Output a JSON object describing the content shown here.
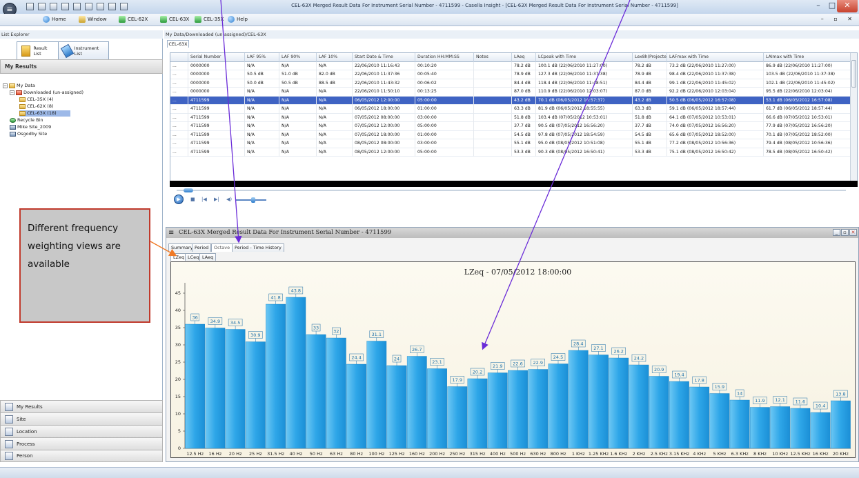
{
  "app": {
    "title": "CEL-63X Merged Result Data For Instrument Serial Number - 4711599 - Casella Insight - [CEL-63X Merged Result Data For Instrument Serial Number - 4711599]",
    "orb_icon": "menu-orb-icon"
  },
  "menu": {
    "items": [
      {
        "label": "Home",
        "icon": "home-icon"
      },
      {
        "label": "Window",
        "icon": "window-icon"
      },
      {
        "label": "CEL-62X",
        "icon": "instrument-icon"
      },
      {
        "label": "CEL-63X",
        "icon": "instrument-icon"
      },
      {
        "label": "CEL-35X",
        "icon": "instrument-icon"
      },
      {
        "label": "Help",
        "icon": "help-icon"
      }
    ]
  },
  "left": {
    "explorer_title": "List Explorer",
    "tabs": [
      {
        "label": "Result List"
      },
      {
        "label": "Instrument List"
      }
    ],
    "section_title": "My Results",
    "tree": {
      "root": "My Data",
      "downloaded": "Downloaded (un-assigned)",
      "cel35": "CEL-35X (4)",
      "cel62": "CEL-62X (8)",
      "cel63": "CEL-63X (18)",
      "recycle": "Recycle Bin",
      "site1": "Mike Site_2009",
      "site2": "Osgodby Site"
    },
    "annotation": "Different frequency weighting views are available",
    "nav": [
      "My Results",
      "Site",
      "Location",
      "Process",
      "Person"
    ]
  },
  "right": {
    "path": "My Data/Downloaded (un-assigned)/CEL-63X",
    "doc_tab": "CEL-63X"
  },
  "grid": {
    "columns": [
      "",
      "Serial Number",
      "LAF 95%",
      "LAF 90%",
      "LAF 10%",
      "Start Date & Time",
      "Duration HH:MM:SS",
      "Notes",
      "LAeq",
      "LCpeak with Time",
      "Lex8h(Projected)",
      "LAFmax with Time",
      "LAImax with Time"
    ],
    "rows": [
      [
        "...",
        "0000000",
        "N/A",
        "N/A",
        "N/A",
        "22/06/2010 11:16:43",
        "00:10:20",
        "",
        "78.2 dB",
        "100.1 dB (22/06/2010 11:27:00)",
        "78.2 dB",
        "73.2 dB (22/06/2010 11:27:00)",
        "86.9 dB (22/06/2010 11:27:00)"
      ],
      [
        "...",
        "0000000",
        "50.5 dB",
        "51.0 dB",
        "82.0 dB",
        "22/06/2010 11:37:36",
        "00:05:40",
        "",
        "78.9 dB",
        "127.3 dB (22/06/2010 11:37:38)",
        "78.9 dB",
        "98.4 dB (22/06/2010 11:37:38)",
        "103.5 dB (22/06/2010 11:37:38)"
      ],
      [
        "...",
        "0000000",
        "50.0 dB",
        "50.5 dB",
        "88.5 dB",
        "22/06/2010 11:43:32",
        "00:06:02",
        "",
        "84.4 dB",
        "118.4 dB (22/06/2010 11:48:51)",
        "84.4 dB",
        "99.1 dB (22/06/2010 11:45:02)",
        "102.1 dB (22/06/2010 11:45:02)"
      ],
      [
        "...",
        "0000000",
        "N/A",
        "N/A",
        "N/A",
        "22/06/2010 11:50:10",
        "00:13:25",
        "",
        "87.0 dB",
        "110.9 dB (22/06/2010 12:03:07)",
        "87.0 dB",
        "92.2 dB (22/06/2010 12:03:04)",
        "95.5 dB (22/06/2010 12:03:04)"
      ],
      [
        "...",
        "4711599",
        "N/A",
        "N/A",
        "N/A",
        "06/05/2012 12:00:00",
        "05:00:00",
        "",
        "43.2 dB",
        "70.1 dB (06/05/2012 16:57:37)",
        "43.2 dB",
        "50.5 dB (06/05/2012 16:57:08)",
        "53.1 dB (06/05/2012 16:57:08)"
      ],
      [
        "...",
        "4711599",
        "N/A",
        "N/A",
        "N/A",
        "06/05/2012 18:00:00",
        "01:00:00",
        "",
        "63.3 dB",
        "81.9 dB (06/05/2012 18:55:55)",
        "63.3 dB",
        "59.1 dB (06/05/2012 18:57:44)",
        "61.7 dB (06/05/2012 18:57:44)"
      ],
      [
        "...",
        "4711599",
        "N/A",
        "N/A",
        "N/A",
        "07/05/2012 08:00:00",
        "03:00:00",
        "",
        "51.8 dB",
        "103.4 dB (07/05/2012 10:53:01)",
        "51.8 dB",
        "64.1 dB (07/05/2012 10:53:01)",
        "66.6 dB (07/05/2012 10:53:01)"
      ],
      [
        "...",
        "4711599",
        "N/A",
        "N/A",
        "N/A",
        "07/05/2012 12:00:00",
        "05:00:00",
        "",
        "37.7 dB",
        "90.5 dB (07/05/2012 16:56:20)",
        "37.7 dB",
        "74.0 dB (07/05/2012 16:56:20)",
        "77.9 dB (07/05/2012 16:56:20)"
      ],
      [
        "...",
        "4711599",
        "N/A",
        "N/A",
        "N/A",
        "07/05/2012 18:00:00",
        "01:00:00",
        "",
        "54.5 dB",
        "97.8 dB (07/05/2012 18:54:59)",
        "54.5 dB",
        "65.6 dB (07/05/2012 18:52:00)",
        "70.1 dB (07/05/2012 18:52:00)"
      ],
      [
        "...",
        "4711599",
        "N/A",
        "N/A",
        "N/A",
        "08/05/2012 08:00:00",
        "03:00:00",
        "",
        "55.1 dB",
        "95.0 dB (08/05/2012 10:51:08)",
        "55.1 dB",
        "77.2 dB (08/05/2012 10:56:36)",
        "79.4 dB (08/05/2012 10:56:36)"
      ],
      [
        "...",
        "4711599",
        "N/A",
        "N/A",
        "N/A",
        "08/05/2012 12:00:00",
        "05:00:00",
        "",
        "53.3 dB",
        "90.3 dB (08/05/2012 16:50:41)",
        "53.3 dB",
        "75.1 dB (08/05/2012 16:50:42)",
        "78.5 dB (08/05/2012 16:50:42)"
      ]
    ],
    "selected_index": 4
  },
  "chart_window": {
    "title": "CEL-63X Merged Result Data For Instrument Serial Number - 4711599",
    "tabs": [
      "Summary",
      "Period",
      "Octave",
      "Period - Time History"
    ],
    "active_tab": "Octave",
    "subtabs": [
      "LZeq",
      "LCeq",
      "LAeq"
    ],
    "active_subtab": "LZeq"
  },
  "chart_data": {
    "type": "bar",
    "title": "LZeq  -  07/05/2012 18:00:00",
    "xlabel": "",
    "ylabel": "",
    "ylim": [
      0,
      48
    ],
    "yticks": [
      0,
      5,
      10,
      15,
      20,
      25,
      30,
      35,
      40,
      45
    ],
    "grid": false,
    "bar_color": "#2ea6e8",
    "categories": [
      "12.5 Hz",
      "16 Hz",
      "20 Hz",
      "25 Hz",
      "31.5 Hz",
      "40 Hz",
      "50 Hz",
      "63 Hz",
      "80 Hz",
      "100 Hz",
      "125 Hz",
      "160 Hz",
      "200 Hz",
      "250 Hz",
      "315 Hz",
      "400 Hz",
      "500 Hz",
      "630 Hz",
      "800 Hz",
      "1 KHz",
      "1.25 KHz",
      "1.6 KHz",
      "2 KHz",
      "2.5 KHz",
      "3.15 KHz",
      "4 KHz",
      "5 KHz",
      "6.3 KHz",
      "8 KHz",
      "10 KHz",
      "12.5 KHz",
      "16 KHz",
      "20 KHz"
    ],
    "values": [
      36,
      34.9,
      34.5,
      30.9,
      41.8,
      43.8,
      33,
      32,
      24.4,
      31.1,
      24,
      26.7,
      23.1,
      17.9,
      20.2,
      21.9,
      22.6,
      22.9,
      24.5,
      28.4,
      27.1,
      26.2,
      24.2,
      20.9,
      19.4,
      17.8,
      15.9,
      14,
      11.9,
      12.1,
      11.6,
      10.4,
      13.8
    ]
  }
}
